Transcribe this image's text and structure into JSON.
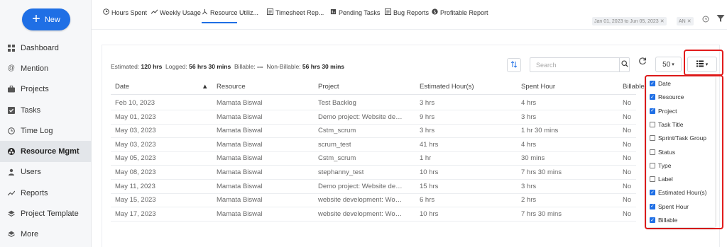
{
  "sidebar": {
    "new_label": "New",
    "items": [
      {
        "label": "Dashboard",
        "icon": "grid-icon"
      },
      {
        "label": "Mention",
        "icon": "at-icon"
      },
      {
        "label": "Projects",
        "icon": "briefcase-icon"
      },
      {
        "label": "Tasks",
        "icon": "checkbox-icon"
      },
      {
        "label": "Time Log",
        "icon": "clock-icon"
      },
      {
        "label": "Resource Mgmt",
        "icon": "resource-icon"
      },
      {
        "label": "Users",
        "icon": "user-icon"
      },
      {
        "label": "Reports",
        "icon": "trend-icon"
      },
      {
        "label": "Project Template",
        "icon": "layers-icon"
      },
      {
        "label": "More",
        "icon": "layers-icon"
      }
    ],
    "active_index": 5
  },
  "tabs": [
    {
      "label": "Hours Spent",
      "icon": "clock-icon"
    },
    {
      "label": "Weekly Usage",
      "icon": "trend-icon"
    },
    {
      "label": "Resource Utiliz...",
      "icon": "resource-icon"
    },
    {
      "label": "Timesheet Rep...",
      "icon": "report-icon"
    },
    {
      "label": "Pending Tasks",
      "icon": "bar-icon"
    },
    {
      "label": "Bug Reports",
      "icon": "report-icon"
    },
    {
      "label": "Profitable Report",
      "icon": "dollar-icon"
    }
  ],
  "filters": {
    "date_range": "Jan 01, 2023 to Jun 05, 2023",
    "assignee": "AN",
    "remove": "✕"
  },
  "summary": {
    "estimated_label": "Estimated:",
    "estimated_value": "120 hrs",
    "logged_label": "Logged:",
    "logged_value": "56 hrs 30 mins",
    "billable_label": "Billable:",
    "billable_value": "---",
    "nonbillable_label": "Non-Billable:",
    "nonbillable_value": "56 hrs 30 mins"
  },
  "toolbar": {
    "search_placeholder": "Search",
    "page_size": "50"
  },
  "table": {
    "columns": [
      "Date",
      "Resource",
      "Project",
      "Estimated Hour(s)",
      "Spent Hour",
      "Billable"
    ],
    "rows": [
      [
        "Feb 10, 2023",
        "Mamata Biswal",
        "Test Backlog",
        "3 hrs",
        "4 hrs",
        "No"
      ],
      [
        "May 01, 2023",
        "Mamata Biswal",
        "Demo project: Website devel...",
        "9 hrs",
        "3 hrs",
        "No"
      ],
      [
        "May 03, 2023",
        "Mamata Biswal",
        "Cstm_scrum",
        "3 hrs",
        "1 hr 30 mins",
        "No"
      ],
      [
        "May 03, 2023",
        "Mamata Biswal",
        "scrum_test",
        "41 hrs",
        "4 hrs",
        "No"
      ],
      [
        "May 05, 2023",
        "Mamata Biswal",
        "Cstm_scrum",
        "1 hr",
        "30 mins",
        "No"
      ],
      [
        "May 08, 2023",
        "Mamata Biswal",
        "stephanny_test",
        "10 hrs",
        "7 hrs 30 mins",
        "No"
      ],
      [
        "May 11, 2023",
        "Mamata Biswal",
        "Demo project: Website devel...",
        "15 hrs",
        "3 hrs",
        "No"
      ],
      [
        "May 15, 2023",
        "Mamata Biswal",
        "website development: Work ...",
        "6 hrs",
        "2 hrs",
        "No"
      ],
      [
        "May 17, 2023",
        "Mamata Biswal",
        "website development: Work ...",
        "10 hrs",
        "7 hrs 30 mins",
        "No"
      ]
    ]
  },
  "column_menu": [
    {
      "label": "Date",
      "checked": true
    },
    {
      "label": "Resource",
      "checked": true
    },
    {
      "label": "Project",
      "checked": true
    },
    {
      "label": "Task Title",
      "checked": false
    },
    {
      "label": "Sprint/Task Group",
      "checked": false
    },
    {
      "label": "Status",
      "checked": false
    },
    {
      "label": "Type",
      "checked": false
    },
    {
      "label": "Label",
      "checked": false
    },
    {
      "label": "Estimated Hour(s)",
      "checked": true
    },
    {
      "label": "Spent Hour",
      "checked": true
    },
    {
      "label": "Billable",
      "checked": true
    }
  ],
  "colors": {
    "accent": "#1f6fe5",
    "highlight": "#e21b1b"
  }
}
